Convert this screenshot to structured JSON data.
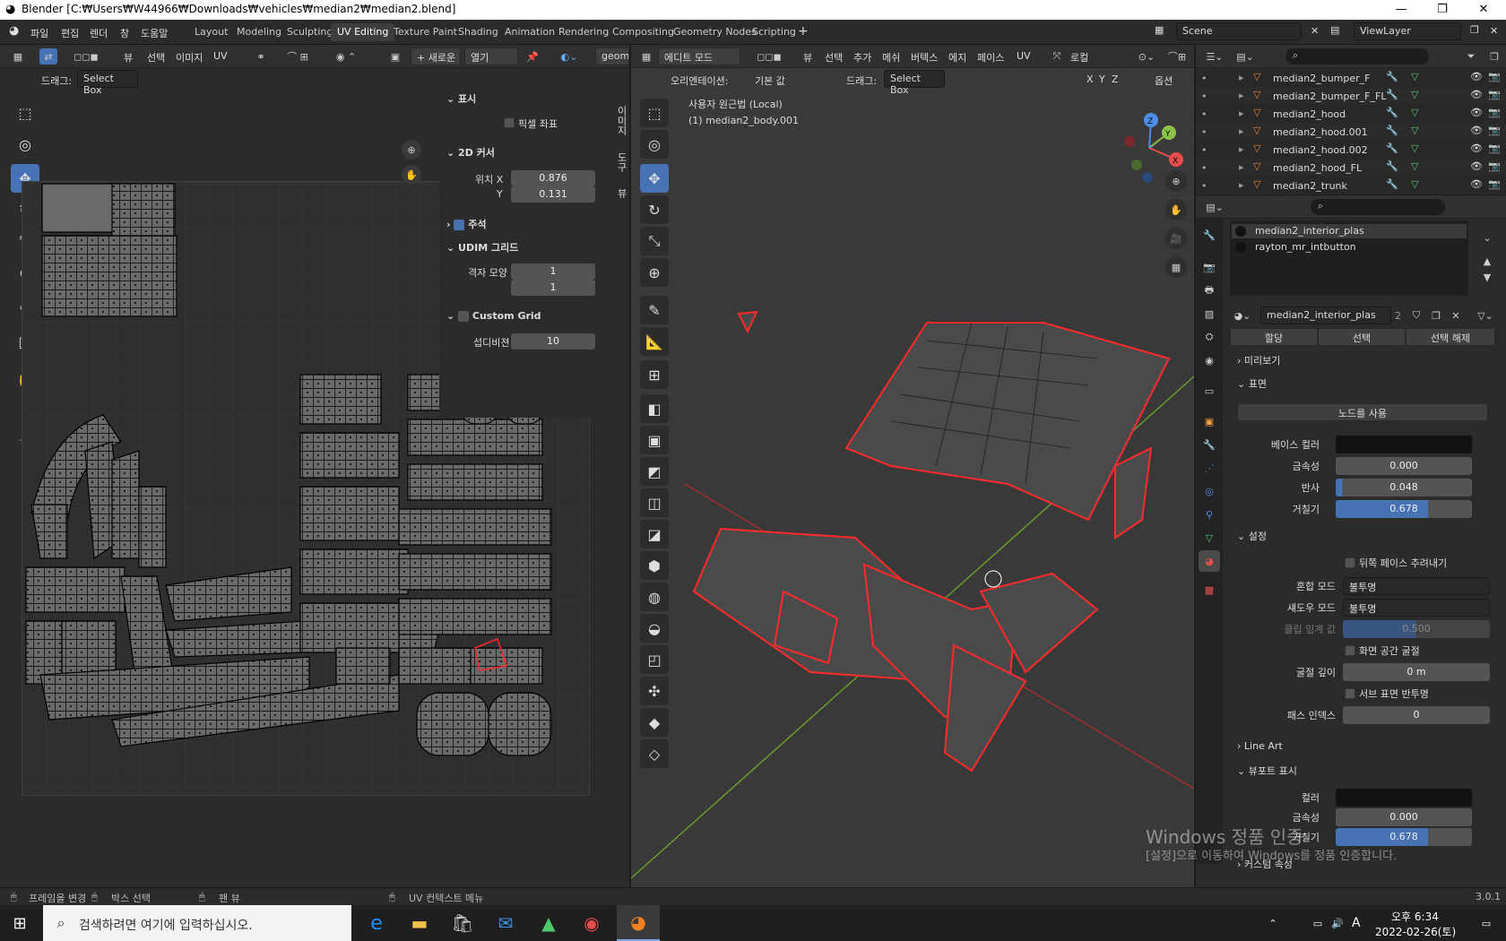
{
  "window": {
    "title": "Blender [C:₩Users₩W44966₩Downloads₩vehicles₩median2₩median2.blend]",
    "min": "—",
    "max": "❐",
    "close": "✕"
  },
  "menu": [
    "파일",
    "편집",
    "렌더",
    "창",
    "도움말"
  ],
  "workspaces": [
    "Layout",
    "Modeling",
    "Sculpting",
    "UV Editing",
    "Texture Paint",
    "Shading",
    "Animation",
    "Rendering",
    "Compositing",
    "Geometry Nodes",
    "Scripting"
  ],
  "scene": "Scene",
  "viewlayer": "ViewLayer",
  "uv": {
    "menu": [
      "뷰",
      "선택",
      "이미지",
      "UV"
    ],
    "new_btn": "+ 새로운",
    "open_btn": "열기",
    "geom": "geom-a",
    "drag_label": "드래그:",
    "drag_value": "Select Box",
    "tabs": [
      "이미지",
      "도구",
      "뷰"
    ],
    "display": {
      "title": "표시",
      "pixel_coords": "픽셀 좌표"
    },
    "cursor": {
      "title": "2D 커서",
      "pos_label": "위치 X",
      "x": "0.876",
      "y_label": "Y",
      "y": "0.131"
    },
    "annotation": "주석",
    "udim": {
      "title": "UDIM 그리드",
      "grid_label": "격자 모양",
      "v1": "1",
      "v2": "1"
    },
    "custom": {
      "title": "Custom Grid",
      "sub_label": "섭디비젼",
      "sub": "10"
    }
  },
  "view3d": {
    "mode": "에디트 모드",
    "menu": [
      "뷰",
      "선택",
      "추가",
      "메쉬",
      "버텍스",
      "에지",
      "페이스",
      "UV"
    ],
    "local": "로컬",
    "orient_label": "오리엔테이션:",
    "orient": "기본 값",
    "drag_label": "드래그:",
    "drag": "Select Box",
    "xyz": [
      "X",
      "Y",
      "Z"
    ],
    "options": "옵션",
    "info1": "사용자 원근법 (Local)",
    "info2": "(1) median2_body.001",
    "gizmo": [
      "X",
      "Y",
      "Z"
    ]
  },
  "outliner": {
    "items": [
      "median2_bumper_F",
      "median2_bumper_F_FL",
      "median2_hood",
      "median2_hood.001",
      "median2_hood.002",
      "median2_hood_FL",
      "median2_trunk"
    ]
  },
  "props": {
    "slots": [
      "median2_interior_plas",
      "rayton_mr_intbutton"
    ],
    "material": "median2_interior_plas",
    "users": "2",
    "assign": [
      "할당",
      "선택",
      "선택 해제"
    ],
    "preview": "미리보기",
    "surface": "표면",
    "use_nodes": "노드를 사용",
    "base_color": "베이스 컬러",
    "metallic_label": "금속성",
    "metallic": "0.000",
    "specular_label": "반사",
    "specular": "0.048",
    "roughness_label": "거칠기",
    "roughness": "0.678",
    "settings": "설정",
    "backface": "뒤쪽 페이스 추려내기",
    "blend_label": "혼합 모드",
    "blend": "불투명",
    "shadow_label": "섀도우 모드",
    "shadow": "불투명",
    "clip_label": "클립 임계 값",
    "clip": "0.500",
    "ssr": "화면 공간 굴절",
    "refr_label": "굴절 깊이",
    "refr": "0 m",
    "sss": "서브 표면 반투명",
    "pass_label": "패스 인덱스",
    "pass": "0",
    "lineart": "Line Art",
    "viewport": "뷰포트 표시",
    "vp_color": "컬러",
    "vp_metal_label": "금속성",
    "vp_metal": "0.000",
    "vp_rough_label": "거칠기",
    "vp_rough": "0.678",
    "custom": "커스텀 속성",
    "watermark1": "Windows 정품 인증",
    "watermark2": "[설정]으로 이동하여 Windows를 정품 인증합니다."
  },
  "status": {
    "s1": "프레임을 변경",
    "s2": "박스 선택",
    "s3": "팬 뷰",
    "s4": "UV 컨텍스트 메뉴",
    "version": "3.0.1"
  },
  "taskbar": {
    "search": "검색하려면 여기에 입력하십시오.",
    "time": "오후 6:34",
    "date": "2022-02-26(토)",
    "ime": "A"
  },
  "colors": {
    "accent": "#4772b3",
    "select": "#ff2a2a",
    "title": "#ffffff"
  }
}
